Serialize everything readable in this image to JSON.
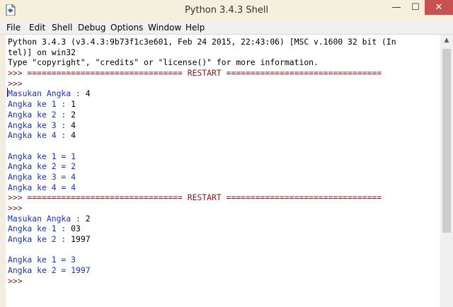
{
  "window": {
    "title": "Python 3.4.3 Shell",
    "controls": {
      "minimize": "—",
      "maximize": "☐",
      "close": "✕"
    }
  },
  "menu": [
    "File",
    "Edit",
    "Shell",
    "Debug",
    "Options",
    "Window",
    "Help"
  ],
  "shell_lines": [
    {
      "kind": "sys",
      "text": "Python 3.4.3 (v3.4.3:9b73f1c3e601, Feb 24 2015, 22:43:06) [MSC v.1600 32 bit (In"
    },
    {
      "kind": "sys",
      "text": "tel)] on win32"
    },
    {
      "kind": "sys",
      "text": "Type \"copyright\", \"credits\" or \"license()\" for more information."
    },
    {
      "kind": "prompt",
      "text": ">>> ================================ RESTART ================================"
    },
    {
      "kind": "prompt",
      "text": ">>> "
    },
    {
      "kind": "io",
      "out": "Masukan Angka : ",
      "inp": "4"
    },
    {
      "kind": "io",
      "out": "Angka ke 1 : ",
      "inp": "1"
    },
    {
      "kind": "io",
      "out": "Angka ke 2 : ",
      "inp": "2"
    },
    {
      "kind": "io",
      "out": "Angka ke 3 : ",
      "inp": "4"
    },
    {
      "kind": "io",
      "out": "Angka ke 4 : ",
      "inp": "4"
    },
    {
      "kind": "blank",
      "text": ""
    },
    {
      "kind": "out",
      "text": "Angka ke 1 = 1"
    },
    {
      "kind": "out",
      "text": "Angka ke 2 = 2"
    },
    {
      "kind": "out",
      "text": "Angka ke 3 = 4"
    },
    {
      "kind": "out",
      "text": "Angka ke 4 = 4"
    },
    {
      "kind": "prompt",
      "text": ">>> ================================ RESTART ================================"
    },
    {
      "kind": "prompt",
      "text": ">>> "
    },
    {
      "kind": "io",
      "out": "Masukan Angka : ",
      "inp": "2"
    },
    {
      "kind": "io",
      "out": "Angka ke 1 : ",
      "inp": "03"
    },
    {
      "kind": "io",
      "out": "Angka ke 2 : ",
      "inp": "1997"
    },
    {
      "kind": "blank",
      "text": ""
    },
    {
      "kind": "out",
      "text": "Angka ke 1 = 3"
    },
    {
      "kind": "out",
      "text": "Angka ke 2 = 1997"
    },
    {
      "kind": "prompt",
      "text": ">>> "
    }
  ],
  "colors": {
    "output": "#1b33c0",
    "prompt": "#7b1b1b",
    "input": "#000000",
    "close_button": "#c75050"
  }
}
